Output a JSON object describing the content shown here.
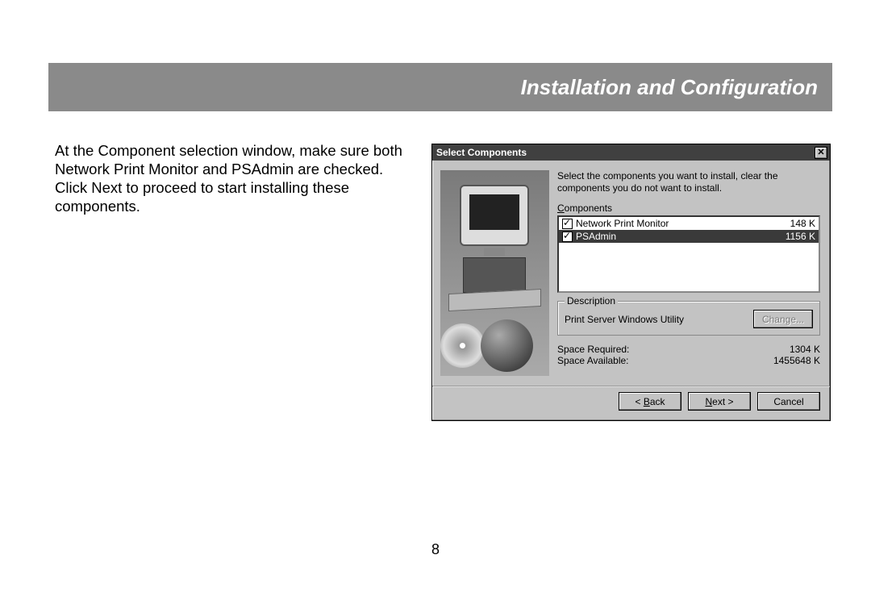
{
  "header": {
    "title": "Installation and Configuration"
  },
  "body_text": "At the Component selection window, make sure both Network Print Monitor and PSAdmin are checked. Click Next to proceed to start installing these components.",
  "page_number": "8",
  "dialog": {
    "title": "Select Components",
    "close_glyph": "✕",
    "instruction": "Select the components you want to install, clear the components you do not want to install.",
    "components_label_u": "C",
    "components_label_rest": "omponents",
    "components": [
      {
        "name": "Network Print Monitor",
        "size": "148 K",
        "checked": true,
        "selected": false
      },
      {
        "name": "PSAdmin",
        "size": "1156 K",
        "checked": true,
        "selected": true
      }
    ],
    "description_legend": "Description",
    "description_text": "Print Server Windows Utility",
    "change_button": "Change...",
    "space_required_label": "Space Required:",
    "space_required_value": "1304 K",
    "space_available_label": "Space Available:",
    "space_available_value": "1455648 K",
    "back_pre": "< ",
    "back_u": "B",
    "back_rest": "ack",
    "next_u": "N",
    "next_rest": "ext >",
    "cancel": "Cancel"
  }
}
